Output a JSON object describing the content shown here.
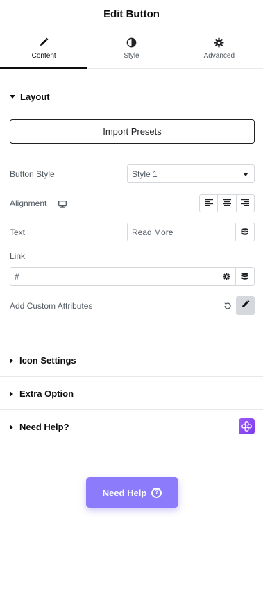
{
  "header": {
    "title": "Edit Button"
  },
  "tabs": [
    {
      "label": "Content",
      "icon": "pencil-icon",
      "active": true
    },
    {
      "label": "Style",
      "icon": "half-circle-icon",
      "active": false
    },
    {
      "label": "Advanced",
      "icon": "gear-icon",
      "active": false
    }
  ],
  "layout": {
    "title": "Layout",
    "import_button": "Import Presets",
    "button_style": {
      "label": "Button Style",
      "value": "Style 1"
    },
    "alignment": {
      "label": "Alignment",
      "device_icon": "desktop-icon",
      "options": [
        "align-left-icon",
        "align-center-icon",
        "align-right-icon"
      ]
    },
    "text": {
      "label": "Text",
      "value": "Read More"
    },
    "link": {
      "label": "Link",
      "value": "#"
    },
    "custom_attributes": {
      "label": "Add Custom Attributes"
    }
  },
  "sections": [
    {
      "title": "Icon Settings"
    },
    {
      "title": "Extra Option"
    },
    {
      "title": "Need Help?"
    }
  ],
  "help_button": {
    "label": "Need Help",
    "icon_char": "?"
  },
  "colors": {
    "accent": "#8c7bfa",
    "badge": "#7c3aed",
    "text": "#0c0d0e",
    "muted": "#515962",
    "border": "#d5d8dc"
  }
}
